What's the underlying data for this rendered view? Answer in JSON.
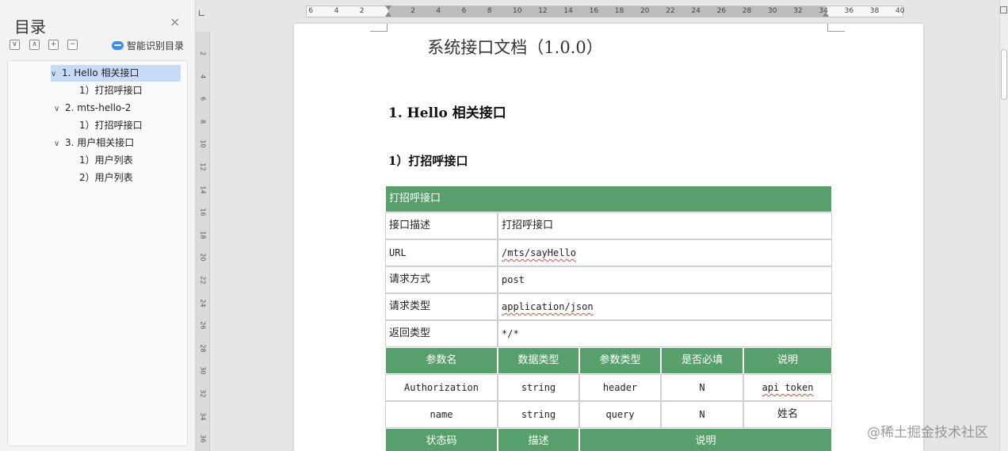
{
  "toc": {
    "title": "目录",
    "close_icon": "×",
    "tools": [
      "∨",
      "∧",
      "+",
      "−"
    ],
    "smart_toc_label": "智能识别目录",
    "items": [
      {
        "label": "1. Hello 相关接口",
        "expanded": true,
        "selected": true
      },
      {
        "label": "1）打招呼接口"
      },
      {
        "label": "2. mts-hello-2",
        "expanded": true
      },
      {
        "label": "1）打招呼接口"
      },
      {
        "label": "3. 用户相关接口",
        "expanded": true
      },
      {
        "label": "1）用户列表"
      },
      {
        "label": "2）用户列表"
      }
    ]
  },
  "rulers": {
    "horizontal_left": [
      "6",
      "4",
      "2"
    ],
    "horizontal_right": [
      "2",
      "4",
      "6",
      "8",
      "10",
      "12",
      "14",
      "16",
      "18",
      "20",
      "22",
      "24",
      "26",
      "28",
      "30",
      "32",
      "34",
      "36",
      "38",
      "40"
    ],
    "vertical": [
      "2",
      "4",
      "6",
      "8",
      "10",
      "12",
      "14",
      "16",
      "18",
      "20",
      "22",
      "24",
      "26",
      "28",
      "30",
      "32",
      "34",
      "36"
    ]
  },
  "document": {
    "title": "系统接口文档（1.0.0）",
    "heading1": "1. Hello 相关接口",
    "heading2": "1）打招呼接口",
    "table": {
      "caption": "打招呼接口",
      "info_rows": [
        {
          "label": "接口描述",
          "value": "打招呼接口"
        },
        {
          "label": "URL",
          "value": "/mts/sayHello"
        },
        {
          "label": "请求方式",
          "value": "post"
        },
        {
          "label": "请求类型",
          "value": "application/json"
        },
        {
          "label": "返回类型",
          "value": "*/*"
        }
      ],
      "param_headers": [
        "参数名",
        "数据类型",
        "参数类型",
        "是否必填",
        "说明"
      ],
      "param_rows": [
        [
          "Authorization",
          "string",
          "header",
          "N",
          "api token"
        ],
        [
          "name",
          "string",
          "query",
          "N",
          "姓名"
        ]
      ],
      "status_headers": [
        "状态码",
        "描述",
        "说明"
      ]
    }
  },
  "watermark": "@稀土掘金技术社区",
  "colors": {
    "table_header_green": "#58a06b",
    "toc_selected": "#c7daf7"
  }
}
